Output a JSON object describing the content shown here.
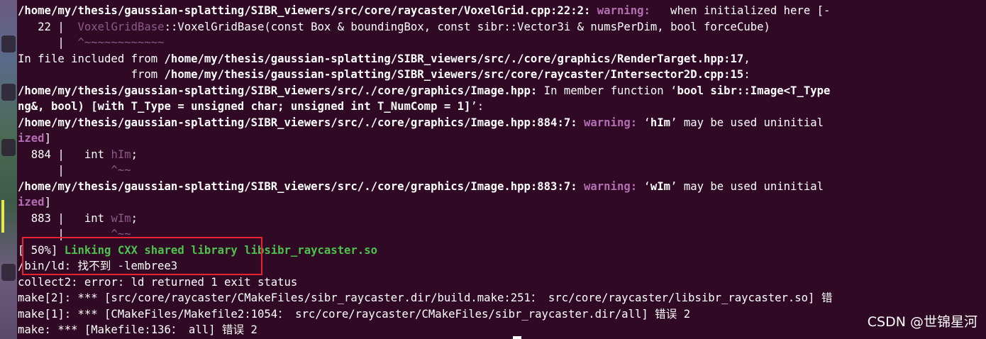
{
  "terminal": {
    "lines": [
      {
        "segments": [
          {
            "text": "/home/my/thesis/gaussian-splatting/SIBR_viewers/src/core/raycaster/VoxelGrid.cpp:22:2: ",
            "cls": "b"
          },
          {
            "text": "warning:",
            "cls": "warn"
          },
          {
            "text": "   when initialized here [-",
            "cls": ""
          }
        ]
      },
      {
        "segments": [
          {
            "text": "   22 |  ",
            "cls": ""
          },
          {
            "text": "VoxelGridBase",
            "cls": "dim"
          },
          {
            "text": "::VoxelGridBase(const Box & boundingBox, const sibr::Vector3i & numsPerDim, bool forceCube)",
            "cls": ""
          }
        ]
      },
      {
        "segments": [
          {
            "text": "      |  ",
            "cls": ""
          },
          {
            "text": "^~~~~~~~~~~~~",
            "cls": "dim"
          }
        ]
      },
      {
        "segments": [
          {
            "text": "In file included from ",
            "cls": ""
          },
          {
            "text": "/home/my/thesis/gaussian-splatting/SIBR_viewers/src/./core/graphics/RenderTarget.hpp:17",
            "cls": "b"
          },
          {
            "text": ",",
            "cls": ""
          }
        ]
      },
      {
        "segments": [
          {
            "text": "                 from ",
            "cls": ""
          },
          {
            "text": "/home/my/thesis/gaussian-splatting/SIBR_viewers/src/core/raycaster/Intersector2D.cpp:15",
            "cls": "b"
          },
          {
            "text": ":",
            "cls": ""
          }
        ]
      },
      {
        "segments": [
          {
            "text": "/home/my/thesis/gaussian-splatting/SIBR_viewers/src/./core/graphics/Image.hpp:",
            "cls": "b"
          },
          {
            "text": " In member function ‘",
            "cls": ""
          },
          {
            "text": "bool sibr::Image<T_Type",
            "cls": "b"
          }
        ]
      },
      {
        "segments": [
          {
            "text": "ng&, bool) [with T_Type = unsigned char; unsigned int T_NumComp = 1]",
            "cls": "b"
          },
          {
            "text": "’:",
            "cls": ""
          }
        ]
      },
      {
        "segments": [
          {
            "text": "/home/my/thesis/gaussian-splatting/SIBR_viewers/src/./core/graphics/Image.hpp:884:7: ",
            "cls": "b"
          },
          {
            "text": "warning:",
            "cls": "warn"
          },
          {
            "text": " ‘",
            "cls": ""
          },
          {
            "text": "hIm",
            "cls": "b"
          },
          {
            "text": "’ may be used uninitial",
            "cls": ""
          }
        ]
      },
      {
        "segments": [
          {
            "text": "ized",
            "cls": "warn"
          },
          {
            "text": "]",
            "cls": ""
          }
        ]
      },
      {
        "segments": [
          {
            "text": "  884 |   int ",
            "cls": ""
          },
          {
            "text": "hIm",
            "cls": "dim"
          },
          {
            "text": ";",
            "cls": ""
          }
        ]
      },
      {
        "segments": [
          {
            "text": "      |       ",
            "cls": ""
          },
          {
            "text": "^~~",
            "cls": "dim"
          }
        ]
      },
      {
        "segments": [
          {
            "text": "/home/my/thesis/gaussian-splatting/SIBR_viewers/src/./core/graphics/Image.hpp:883:7: ",
            "cls": "b"
          },
          {
            "text": "warning:",
            "cls": "warn"
          },
          {
            "text": " ‘",
            "cls": ""
          },
          {
            "text": "wIm",
            "cls": "b"
          },
          {
            "text": "’ may be used uninitial",
            "cls": ""
          }
        ]
      },
      {
        "segments": [
          {
            "text": "ized",
            "cls": "warn"
          },
          {
            "text": "]",
            "cls": ""
          }
        ]
      },
      {
        "segments": [
          {
            "text": "  883 |   int ",
            "cls": ""
          },
          {
            "text": "wIm",
            "cls": "dim"
          },
          {
            "text": ";",
            "cls": ""
          }
        ]
      },
      {
        "segments": [
          {
            "text": "      |       ",
            "cls": ""
          },
          {
            "text": "^~~",
            "cls": "dim"
          }
        ]
      },
      {
        "segments": [
          {
            "text": "[ 50%] ",
            "cls": ""
          },
          {
            "text": "Linking CXX shared library libsibr_raycaster.so",
            "cls": "green"
          }
        ]
      },
      {
        "segments": [
          {
            "text": "/bin/ld: ",
            "cls": ""
          },
          {
            "text": "找不到",
            "cls": "cjk"
          },
          {
            "text": " -lembree3",
            "cls": ""
          }
        ]
      },
      {
        "segments": [
          {
            "text": "collect2: error: ld returned 1 exit status",
            "cls": ""
          }
        ]
      },
      {
        "segments": [
          {
            "text": "make[2]: *** [src/core/raycaster/CMakeFiles/sibr_raycaster.dir/build.make:251",
            "cls": ""
          },
          {
            "text": "：",
            "cls": "cjk"
          },
          {
            "text": " src/core/raycaster/libsibr_raycaster.so] ",
            "cls": ""
          },
          {
            "text": "错",
            "cls": "cjk"
          }
        ]
      },
      {
        "segments": [
          {
            "text": "make[1]: *** [CMakeFiles/Makefile2:1054",
            "cls": ""
          },
          {
            "text": "：",
            "cls": "cjk"
          },
          {
            "text": " src/core/raycaster/CMakeFiles/sibr_raycaster.dir/all] ",
            "cls": ""
          },
          {
            "text": "错误",
            "cls": "cjk"
          },
          {
            "text": " 2",
            "cls": ""
          }
        ]
      },
      {
        "segments": [
          {
            "text": "make: *** [Makefile:136",
            "cls": ""
          },
          {
            "text": "：",
            "cls": "cjk"
          },
          {
            "text": " all] ",
            "cls": ""
          },
          {
            "text": "错误",
            "cls": "cjk"
          },
          {
            "text": " 2",
            "cls": ""
          }
        ]
      }
    ]
  },
  "watermark": "CSDN @世锦星河",
  "colors": {
    "background": "#300a24",
    "warning": "#b46eb4",
    "success": "#4ec24e",
    "highlight_box": "#e8222f"
  }
}
